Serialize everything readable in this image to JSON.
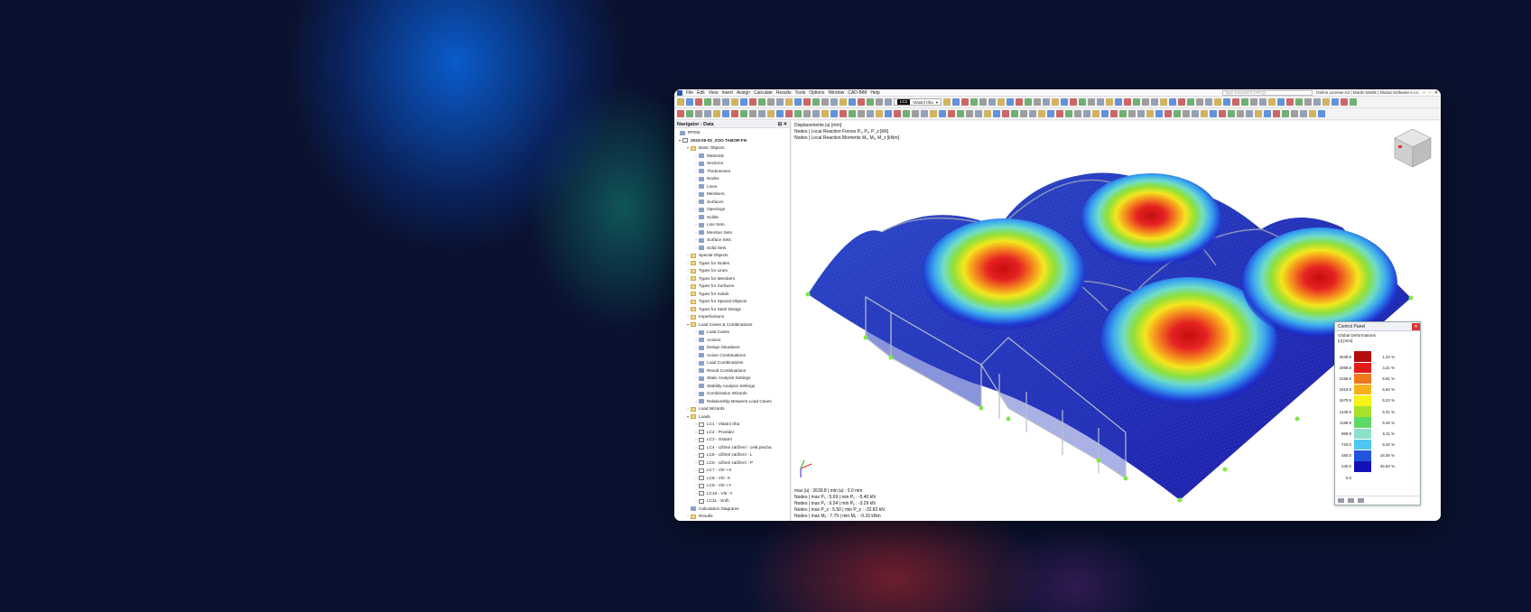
{
  "menu": {
    "items": [
      "File",
      "Edit",
      "View",
      "Insert",
      "Assign",
      "Calculate",
      "Results",
      "Tools",
      "Options",
      "Window",
      "CAD-BIM",
      "Help"
    ],
    "search_placeholder": "Type a keyword (Alt+Q)",
    "license": "Online License A2 | Martin Motlik | Dlubal Software s.r.o."
  },
  "toolbar": {
    "lc_id": "LC1",
    "lc_name": "Vlastní tíha"
  },
  "navigator": {
    "title": "Navigator - Data",
    "root": "RFEM",
    "project": "2023-05-02_ZOO TABOR-FN",
    "items": [
      {
        "label": "Basic Objects",
        "lvl": 1,
        "open": true,
        "type": "folder"
      },
      {
        "label": "Materials",
        "lvl": 2,
        "type": "item"
      },
      {
        "label": "Sections",
        "lvl": 2,
        "type": "item"
      },
      {
        "label": "Thicknesses",
        "lvl": 2,
        "type": "item"
      },
      {
        "label": "Nodes",
        "lvl": 2,
        "type": "item"
      },
      {
        "label": "Lines",
        "lvl": 2,
        "type": "item"
      },
      {
        "label": "Members",
        "lvl": 2,
        "type": "item"
      },
      {
        "label": "Surfaces",
        "lvl": 2,
        "type": "item"
      },
      {
        "label": "Openings",
        "lvl": 2,
        "type": "item"
      },
      {
        "label": "Solids",
        "lvl": 2,
        "type": "item"
      },
      {
        "label": "Line Sets",
        "lvl": 2,
        "type": "item"
      },
      {
        "label": "Member Sets",
        "lvl": 2,
        "type": "item"
      },
      {
        "label": "Surface Sets",
        "lvl": 2,
        "type": "item"
      },
      {
        "label": "Solid Sets",
        "lvl": 2,
        "type": "item"
      },
      {
        "label": "Special Objects",
        "lvl": 1,
        "type": "folder"
      },
      {
        "label": "Types for Nodes",
        "lvl": 1,
        "type": "folder"
      },
      {
        "label": "Types for Lines",
        "lvl": 1,
        "type": "folder"
      },
      {
        "label": "Types for Members",
        "lvl": 1,
        "type": "folder"
      },
      {
        "label": "Types for Surfaces",
        "lvl": 1,
        "type": "folder"
      },
      {
        "label": "Types for Solids",
        "lvl": 1,
        "type": "folder"
      },
      {
        "label": "Types for Special Objects",
        "lvl": 1,
        "type": "folder"
      },
      {
        "label": "Types for Steel Design",
        "lvl": 1,
        "type": "folder"
      },
      {
        "label": "Imperfections",
        "lvl": 1,
        "type": "folder"
      },
      {
        "label": "Load Cases & Combinations",
        "lvl": 1,
        "open": true,
        "type": "folder"
      },
      {
        "label": "Load Cases",
        "lvl": 2,
        "type": "item"
      },
      {
        "label": "Actions",
        "lvl": 2,
        "type": "item"
      },
      {
        "label": "Design Situations",
        "lvl": 2,
        "type": "item"
      },
      {
        "label": "Action Combinations",
        "lvl": 2,
        "type": "item"
      },
      {
        "label": "Load Combinations",
        "lvl": 2,
        "type": "item"
      },
      {
        "label": "Result Combinations",
        "lvl": 2,
        "type": "item"
      },
      {
        "label": "Static Analysis Settings",
        "lvl": 2,
        "type": "item"
      },
      {
        "label": "Stability Analysis Settings",
        "lvl": 2,
        "type": "item"
      },
      {
        "label": "Combination Wizards",
        "lvl": 2,
        "type": "item"
      },
      {
        "label": "Relationship Between Load Cases",
        "lvl": 2,
        "type": "item"
      },
      {
        "label": "Load Wizards",
        "lvl": 1,
        "type": "folder"
      },
      {
        "label": "Loads",
        "lvl": 1,
        "open": true,
        "type": "folder"
      },
      {
        "label": "LC1 - Vlastní tíha",
        "lvl": 2,
        "type": "pf"
      },
      {
        "label": "LC2 - Prostání",
        "lvl": 2,
        "type": "pf"
      },
      {
        "label": "LC3 - Ostatní",
        "lvl": 2,
        "type": "pf"
      },
      {
        "label": "LC4 - Užitné zatížení - celá plocha",
        "lvl": 2,
        "type": "pf"
      },
      {
        "label": "LC5 - Užitné zatížení - L",
        "lvl": 2,
        "type": "pf"
      },
      {
        "label": "LC6 - Užitné zatížení - P",
        "lvl": 2,
        "type": "pf"
      },
      {
        "label": "LC7 - Vítr +X",
        "lvl": 2,
        "type": "pf"
      },
      {
        "label": "LC8 - Vítr -X",
        "lvl": 2,
        "type": "pf"
      },
      {
        "label": "LC9 - Vítr +Y",
        "lvl": 2,
        "type": "pf"
      },
      {
        "label": "LC10 - Vítr -Y",
        "lvl": 2,
        "type": "pf"
      },
      {
        "label": "LC11 - Sníh",
        "lvl": 2,
        "type": "pf"
      },
      {
        "label": "Calculation Diagrams",
        "lvl": 1,
        "type": "item"
      },
      {
        "label": "Results",
        "lvl": 1,
        "type": "folder"
      }
    ]
  },
  "view": {
    "header": [
      "Displacements |u| [mm]",
      "Nodes | Local Reaction Forces Pₓ, Pᵧ, P_z [kN]",
      "Nodes | Local Reaction Moments Mₓ, Mᵧ, M_z [kNm]"
    ],
    "footer": [
      "max |u| : 2639.8 | min |u| : 0.0 mm",
      "Nodes | max Pₓ : 5.69 | min Pₓ : -5.40 kN",
      "Nodes | max Pᵧ : 6.24 | min Pᵧ : -3.29 kN",
      "Nodes | max P_z : 5.50 | min P_z : -32.82 kN",
      "Nodes | max Mₓ : 7.79 | min Mₓ : -0.33 kNm"
    ]
  },
  "control_panel": {
    "title": "Control Panel",
    "subtitle": "Global Deformations",
    "unit": "|u| [mm]",
    "legend": [
      {
        "value": "2639.8",
        "color": "#b30d0d",
        "pct": "1.22 %"
      },
      {
        "value": "2399.8",
        "color": "#e31a1a",
        "pct": "4.21 %"
      },
      {
        "value": "2159.8",
        "color": "#f2781e",
        "pct": "5.81 %"
      },
      {
        "value": "1919.8",
        "color": "#f5b21d",
        "pct": "5.84 %"
      },
      {
        "value": "1679.9",
        "color": "#f6f21a",
        "pct": "5.22 %"
      },
      {
        "value": "1439.9",
        "color": "#a8e02a",
        "pct": "5.31 %"
      },
      {
        "value": "1199.9",
        "color": "#5fd86a",
        "pct": "5.49 %"
      },
      {
        "value": "959.9",
        "color": "#8ee0c9",
        "pct": "6.11 %"
      },
      {
        "value": "720.0",
        "color": "#4fc6ef",
        "pct": "9.32 %"
      },
      {
        "value": "480.0",
        "color": "#2255dd",
        "pct": "16.05 %"
      },
      {
        "value": "240.0",
        "color": "#1511b8",
        "pct": "36.82 %"
      },
      {
        "value": "0.0",
        "color": "",
        "pct": ""
      }
    ]
  }
}
